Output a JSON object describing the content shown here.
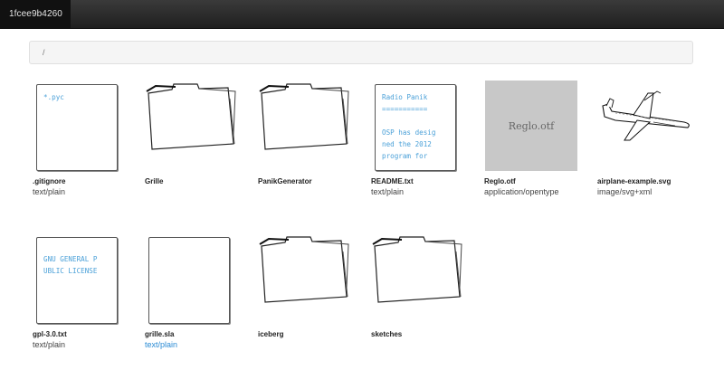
{
  "navbar": {
    "brand": "1fcee9b4260"
  },
  "breadcrumb": {
    "path": "/"
  },
  "files": [
    {
      "name": ".gitignore",
      "type": "text/plain",
      "kind": "text",
      "preview": "*.pyc"
    },
    {
      "name": "Grille",
      "kind": "folder"
    },
    {
      "name": "PanikGenerator",
      "kind": "folder"
    },
    {
      "name": "README.txt",
      "type": "text/plain",
      "kind": "text",
      "preview": "Radio Panik\n===========\n\nOSP has desig\nned the 2012\nprogram for "
    },
    {
      "name": "Reglo.otf",
      "type": "application/opentype",
      "kind": "font",
      "preview": "Reglo.otf"
    },
    {
      "name": "airplane-example.svg",
      "type": "image/svg+xml",
      "kind": "image"
    },
    {
      "name": "gpl-3.0.txt",
      "type": "text/plain",
      "kind": "text",
      "preview": "GNU GENERAL P\nUBLIC LICENSE"
    },
    {
      "name": "grille.sla",
      "type": "text/plain",
      "kind": "text",
      "preview": "",
      "type_link": true
    },
    {
      "name": "iceberg",
      "kind": "folder"
    },
    {
      "name": "sketches",
      "kind": "folder"
    }
  ],
  "colors": {
    "navbar": "#222222",
    "link": "#2a8bd4",
    "preview_text": "#4aa0d8",
    "font_bg": "#c8c8c8"
  }
}
